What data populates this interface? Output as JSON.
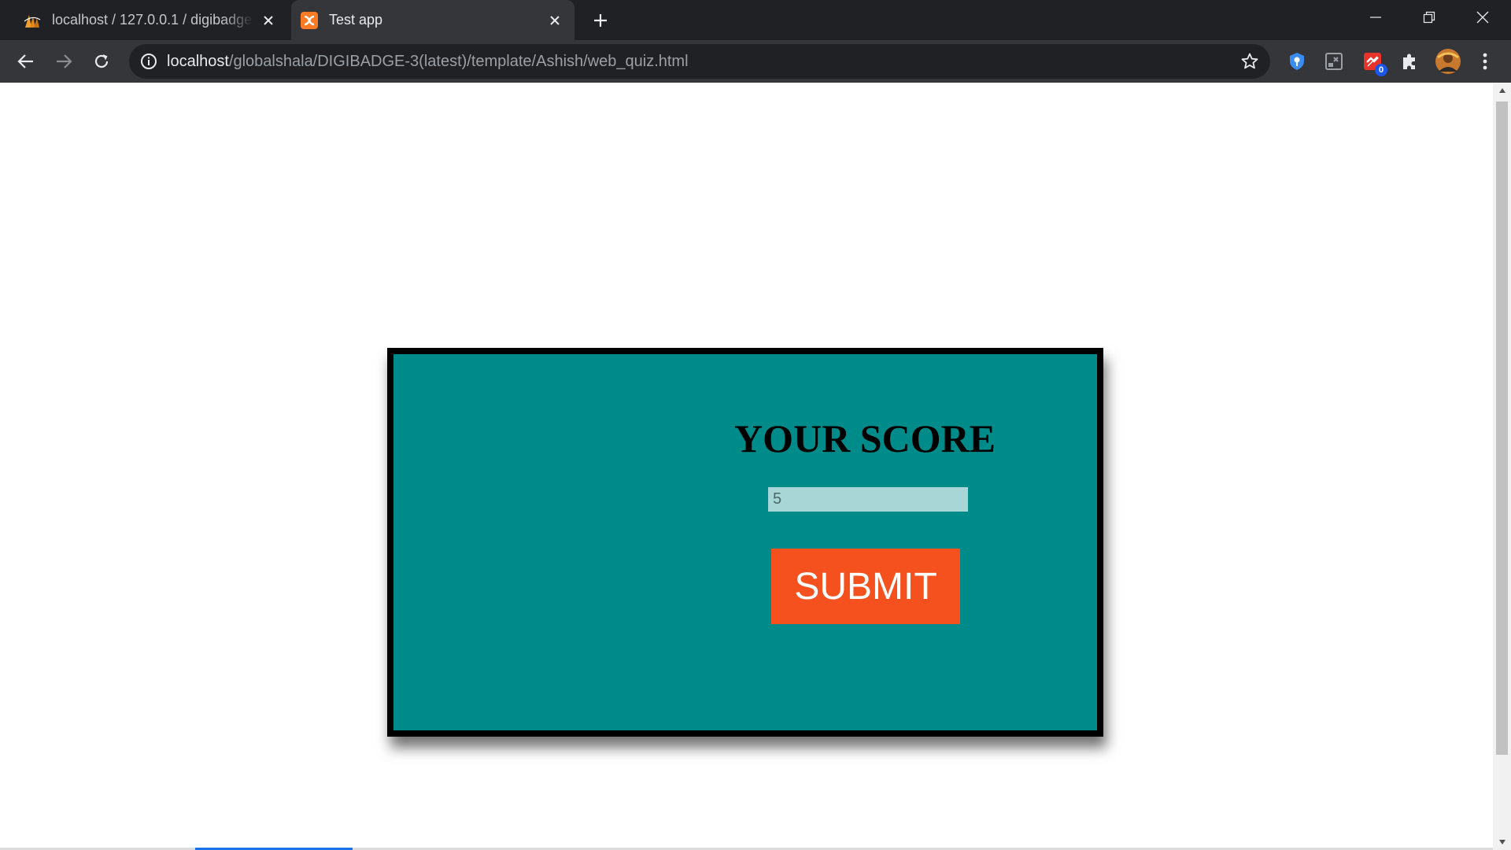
{
  "browser": {
    "tabs": [
      {
        "title": "localhost / 127.0.0.1 / digibadge",
        "active": false,
        "favicon": "phpmyadmin-icon"
      },
      {
        "title": "Test app",
        "active": true,
        "favicon": "xampp-icon"
      }
    ],
    "new_tab_icon": "plus-icon",
    "url": {
      "host": "localhost",
      "path": "/globalshala/DIGIBADGE-3(latest)/template/Ashish/web_quiz.html"
    },
    "extensions": [
      {
        "name": "password-manager-icon"
      },
      {
        "name": "extension-icon"
      },
      {
        "name": "extension-icon",
        "badge": "0"
      },
      {
        "name": "puzzle-icon"
      },
      {
        "name": "profile-avatar"
      }
    ]
  },
  "page": {
    "heading": "YOUR SCORE",
    "score_value": "5",
    "submit_label": "SUBMIT"
  },
  "colors": {
    "card_bg": "#008b8b",
    "card_border": "#000000",
    "input_bg": "#a8d5d5",
    "submit_bg": "#f4511e",
    "chrome_dark": "#202124",
    "chrome_toolbar": "#35363a"
  }
}
